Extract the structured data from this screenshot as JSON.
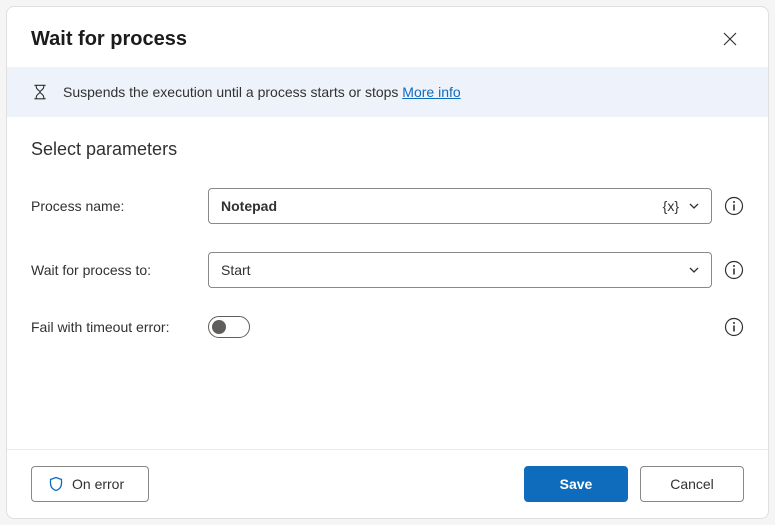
{
  "header": {
    "title": "Wait for process"
  },
  "info": {
    "text": "Suspends the execution until a process starts or stops",
    "link": "More info"
  },
  "section": {
    "title": "Select parameters"
  },
  "fields": {
    "process_name": {
      "label": "Process name:",
      "value": "Notepad"
    },
    "wait_for": {
      "label": "Wait for process to:",
      "value": "Start"
    },
    "fail_timeout": {
      "label": "Fail with timeout error:",
      "on": false
    }
  },
  "footer": {
    "on_error": "On error",
    "save": "Save",
    "cancel": "Cancel"
  }
}
